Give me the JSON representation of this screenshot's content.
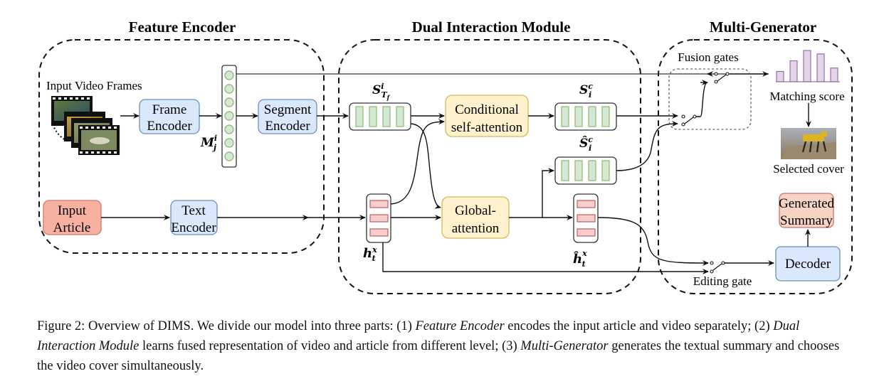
{
  "sections": {
    "feature_encoder": "Feature Encoder",
    "dual_interaction": "Dual Interaction Module",
    "multi_generator": "Multi-Generator"
  },
  "nodes": {
    "input_video_frames": "Input Video Frames",
    "frame_encoder": [
      "Frame",
      "Encoder"
    ],
    "segment_encoder": [
      "Segment",
      "Encoder"
    ],
    "input_article": [
      "Input",
      "Article"
    ],
    "text_encoder": [
      "Text",
      "Encoder"
    ],
    "conditional_self_attention": [
      "Conditional",
      "self-attention"
    ],
    "global_attention": [
      "Global-",
      "attention"
    ],
    "fusion_gates": "Fusion gates",
    "matching_score": "Matching score",
    "selected_cover": "Selected cover",
    "generated_summary": [
      "Generated",
      "Summary"
    ],
    "decoder": "Decoder",
    "editing_gate": "Editing gate"
  },
  "symbols": {
    "M": {
      "base": "M",
      "sup": "i",
      "sub": "j"
    },
    "S_Tf": {
      "base": "S",
      "sup": "i",
      "sub": "T",
      "subsub": "f"
    },
    "S_c": {
      "base": "S",
      "sup": "c",
      "sub": "i"
    },
    "S_hat_c": {
      "base": "Ŝ",
      "sup": "c",
      "sub": "i"
    },
    "h_x": {
      "base": "h",
      "sup": "x",
      "sub": "t"
    },
    "h_hat_x": {
      "base": "ĥ",
      "sup": "x",
      "sub": "t"
    }
  },
  "matching_score_bars": [
    0.33,
    0.67,
    1.0,
    0.89,
    0.44
  ],
  "colors": {
    "blue_fill": "#dae8fc",
    "blue_stroke": "#6c8ebf",
    "yellow_fill": "#fff2cc",
    "yellow_stroke": "#d6b656",
    "red_fill": "#f8cecc",
    "red_stroke": "#b85450",
    "salmon_fill": "#f8b1a0",
    "salmon_stroke": "#d0776a",
    "summary_fill": "#f7d3c6",
    "summary_stroke": "#c8766a",
    "green_fill": "#d5e8d4",
    "green_stroke": "#82b366",
    "purple_fill": "#e1d5e7",
    "purple_stroke": "#9673a6"
  },
  "caption": {
    "prefix": "Figure 2: Overview of DIMS. We divide our model into three parts: (1) ",
    "fe": "Feature Encoder",
    "part1": " encodes the input article and video separately; (2) ",
    "dim": "Dual Interaction Module",
    "part2": " learns fused representation of video and article from different level; (3) ",
    "mg": "Multi-Generator",
    "part3": " generates the textual summary and chooses the video cover simultaneously."
  }
}
